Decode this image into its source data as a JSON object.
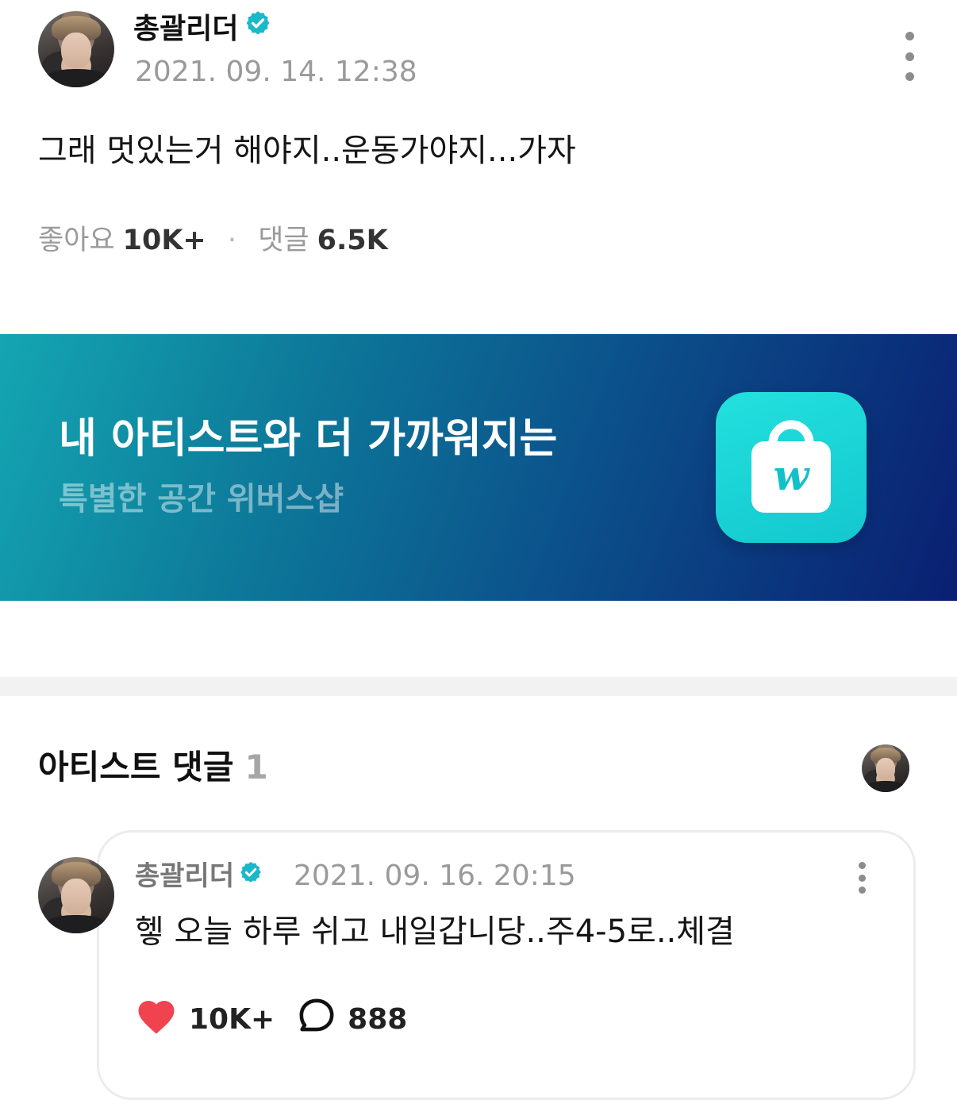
{
  "post": {
    "author": "총괄리더",
    "date": "2021. 09. 14. 12:38",
    "body": "그래 멋있는거 해야지..운동가야지...가자",
    "likes_label": "좋아요",
    "likes_count": "10K+",
    "separator": "·",
    "comments_label": "댓글",
    "comments_count": "6.5K"
  },
  "banner": {
    "headline": "내 아티스트와 더 가까워지는",
    "subline": "특별한 공간 위버스샵",
    "icon": "weverse-shop-bag-icon",
    "icon_letter": "w",
    "colors": {
      "gradient_start": "#14a6b2",
      "gradient_end": "#0a1f72",
      "icon_bg": "#13c8cf"
    }
  },
  "artist_comments": {
    "title": "아티스트 댓글",
    "count": "1",
    "comments": [
      {
        "author": "총괄리더",
        "date": "2021. 09. 16. 20:15",
        "body": "헿 오늘 하루 쉬고 내일갑니당..주4-5로..체결",
        "likes": "10K+",
        "replies": "888"
      }
    ]
  },
  "colors": {
    "verified": "#1bb8c9",
    "heart": "#f0424f",
    "muted_text": "#9a9a9a"
  }
}
